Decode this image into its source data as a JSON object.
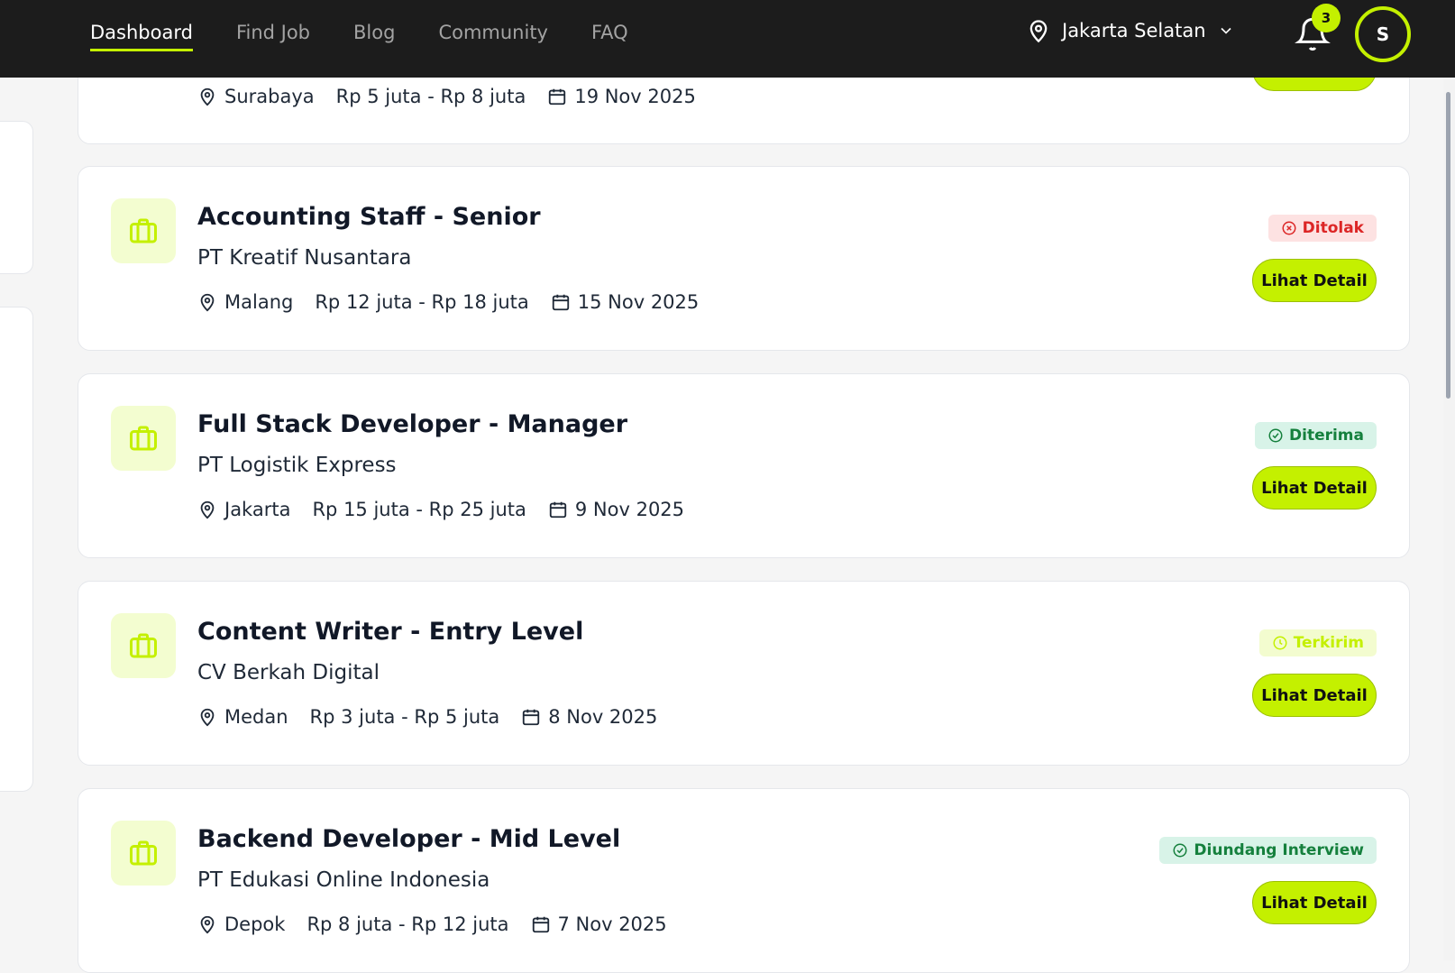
{
  "nav": {
    "items": [
      {
        "label": "Dashboard",
        "active": true
      },
      {
        "label": "Find Job",
        "active": false
      },
      {
        "label": "Blog",
        "active": false
      },
      {
        "label": "Community",
        "active": false
      },
      {
        "label": "FAQ",
        "active": false
      }
    ]
  },
  "location": {
    "label": "Jakarta Selatan"
  },
  "notifications": {
    "count": "3"
  },
  "user": {
    "initial": "S"
  },
  "colors": {
    "accent": "#c4f000",
    "topbar": "#1c1c1c"
  },
  "top_card": {
    "location": "Surabaya",
    "salary": "Rp 5 juta - Rp 8 juta",
    "date": "19 Nov 2025",
    "button": "Lihat Detail"
  },
  "jobs": [
    {
      "title": "Accounting Staff - Senior",
      "company": "PT Kreatif Nusantara",
      "location": "Malang",
      "salary": "Rp 12 juta - Rp 18 juta",
      "date": "15 Nov 2025",
      "status": "Ditolak",
      "status_icon": "x-circle-icon",
      "button": "Lihat Detail"
    },
    {
      "title": "Full Stack Developer - Manager",
      "company": "PT Logistik Express",
      "location": "Jakarta",
      "salary": "Rp 15 juta - Rp 25 juta",
      "date": "9 Nov 2025",
      "status": "Diterima",
      "status_icon": "check-circle-icon",
      "button": "Lihat Detail"
    },
    {
      "title": "Content Writer - Entry Level",
      "company": "CV Berkah Digital",
      "location": "Medan",
      "salary": "Rp 3 juta - Rp 5 juta",
      "date": "8 Nov 2025",
      "status": "Terkirim",
      "status_icon": "clock-icon",
      "button": "Lihat Detail"
    },
    {
      "title": "Backend Developer - Mid Level",
      "company": "PT Edukasi Online Indonesia",
      "location": "Depok",
      "salary": "Rp 8 juta - Rp 12 juta",
      "date": "7 Nov 2025",
      "status": "Diundang Interview",
      "status_icon": "check-circle-icon",
      "button": "Lihat Detail"
    }
  ]
}
